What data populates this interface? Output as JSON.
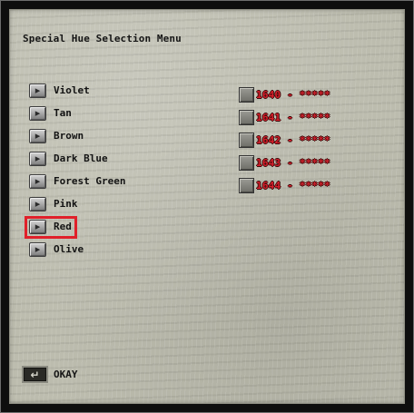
{
  "menu": {
    "title": "Special Hue Selection Menu"
  },
  "hues": [
    {
      "label": "Violet",
      "icon": "arrow-right-icon"
    },
    {
      "label": "Tan",
      "icon": "arrow-right-icon"
    },
    {
      "label": "Brown",
      "icon": "arrow-right-icon"
    },
    {
      "label": "Dark Blue",
      "icon": "arrow-right-icon"
    },
    {
      "label": "Forest Green",
      "icon": "arrow-right-icon"
    },
    {
      "label": "Pink",
      "icon": "arrow-right-icon"
    },
    {
      "label": "Red",
      "icon": "arrow-right-icon",
      "selected": true
    },
    {
      "label": "Olive",
      "icon": "arrow-right-icon"
    }
  ],
  "swatches": [
    {
      "label": "1640 - *****",
      "hue": 1640
    },
    {
      "label": "1641 - *****",
      "hue": 1641
    },
    {
      "label": "1642 - *****",
      "hue": 1642
    },
    {
      "label": "1643 - *****",
      "hue": 1643
    },
    {
      "label": "1644 - *****",
      "hue": 1644
    }
  ],
  "footer": {
    "okay_label": "OKAY",
    "okay_icon": "return-arrow-icon"
  },
  "colors": {
    "parchment": "#bcbcae",
    "frame": "#0e0e0e",
    "selection_outline": "#e0202a",
    "swatch_text": "#d8202c"
  }
}
